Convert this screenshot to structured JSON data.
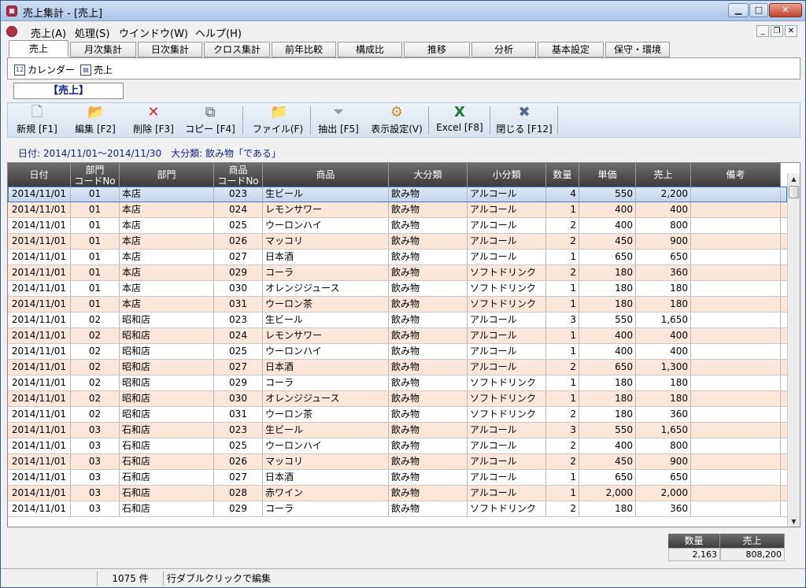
{
  "window": {
    "title": "売上集計 - [売上]"
  },
  "menu": [
    "売上(A)",
    "処理(S)",
    "ウインドウ(W)",
    "ヘルプ(H)"
  ],
  "tabs": [
    "売上",
    "月次集計",
    "日次集計",
    "クロス集計",
    "前年比較",
    "構成比",
    "推移",
    "分析",
    "基本設定",
    "保守・環境"
  ],
  "subnav": [
    {
      "label": "カレンダー",
      "icon": "calendar-icon"
    },
    {
      "label": "売上",
      "icon": "copy-icon"
    }
  ],
  "section_title": "【売上】",
  "toolbar": [
    {
      "label": "新規 [F1]",
      "icon": "new-document-icon"
    },
    {
      "label": "編集 [F2]",
      "icon": "edit-folder-icon"
    },
    {
      "label": "削除 [F3]",
      "icon": "delete-x-icon"
    },
    {
      "label": "コピー [F4]",
      "icon": "copy-icon"
    },
    {
      "label": "ファイル(F)",
      "icon": "folder-icon"
    },
    {
      "label": "抽出 [F5]",
      "icon": "filter-funnel-icon"
    },
    {
      "label": "表示設定(V)",
      "icon": "settings-joystick-icon"
    },
    {
      "label": "Excel [F8]",
      "icon": "excel-icon"
    },
    {
      "label": "閉じる [F12]",
      "icon": "close-x-icon"
    }
  ],
  "filter_text": "日付: 2014/11/01～2014/11/30　大分類: 飲み物「である」",
  "columns": [
    {
      "l1": "日付",
      "l2": ""
    },
    {
      "l1": "部門",
      "l2": "コードNo"
    },
    {
      "l1": "部門",
      "l2": ""
    },
    {
      "l1": "商品",
      "l2": "コードNo"
    },
    {
      "l1": "商品",
      "l2": ""
    },
    {
      "l1": "大分類",
      "l2": ""
    },
    {
      "l1": "小分類",
      "l2": ""
    },
    {
      "l1": "数量",
      "l2": ""
    },
    {
      "l1": "単価",
      "l2": ""
    },
    {
      "l1": "売上",
      "l2": ""
    },
    {
      "l1": "備考",
      "l2": ""
    }
  ],
  "rows": [
    [
      "2014/11/01",
      "01",
      "本店",
      "023",
      "生ビール",
      "飲み物",
      "アルコール",
      "4",
      "550",
      "2,200",
      ""
    ],
    [
      "2014/11/01",
      "01",
      "本店",
      "024",
      "レモンサワー",
      "飲み物",
      "アルコール",
      "1",
      "400",
      "400",
      ""
    ],
    [
      "2014/11/01",
      "01",
      "本店",
      "025",
      "ウーロンハイ",
      "飲み物",
      "アルコール",
      "2",
      "400",
      "800",
      ""
    ],
    [
      "2014/11/01",
      "01",
      "本店",
      "026",
      "マッコリ",
      "飲み物",
      "アルコール",
      "2",
      "450",
      "900",
      ""
    ],
    [
      "2014/11/01",
      "01",
      "本店",
      "027",
      "日本酒",
      "飲み物",
      "アルコール",
      "1",
      "650",
      "650",
      ""
    ],
    [
      "2014/11/01",
      "01",
      "本店",
      "029",
      "コーラ",
      "飲み物",
      "ソフトドリンク",
      "2",
      "180",
      "360",
      ""
    ],
    [
      "2014/11/01",
      "01",
      "本店",
      "030",
      "オレンジジュース",
      "飲み物",
      "ソフトドリンク",
      "1",
      "180",
      "180",
      ""
    ],
    [
      "2014/11/01",
      "01",
      "本店",
      "031",
      "ウーロン茶",
      "飲み物",
      "ソフトドリンク",
      "1",
      "180",
      "180",
      ""
    ],
    [
      "2014/11/01",
      "02",
      "昭和店",
      "023",
      "生ビール",
      "飲み物",
      "アルコール",
      "3",
      "550",
      "1,650",
      ""
    ],
    [
      "2014/11/01",
      "02",
      "昭和店",
      "024",
      "レモンサワー",
      "飲み物",
      "アルコール",
      "1",
      "400",
      "400",
      ""
    ],
    [
      "2014/11/01",
      "02",
      "昭和店",
      "025",
      "ウーロンハイ",
      "飲み物",
      "アルコール",
      "1",
      "400",
      "400",
      ""
    ],
    [
      "2014/11/01",
      "02",
      "昭和店",
      "027",
      "日本酒",
      "飲み物",
      "アルコール",
      "2",
      "650",
      "1,300",
      ""
    ],
    [
      "2014/11/01",
      "02",
      "昭和店",
      "029",
      "コーラ",
      "飲み物",
      "ソフトドリンク",
      "1",
      "180",
      "180",
      ""
    ],
    [
      "2014/11/01",
      "02",
      "昭和店",
      "030",
      "オレンジジュース",
      "飲み物",
      "ソフトドリンク",
      "1",
      "180",
      "180",
      ""
    ],
    [
      "2014/11/01",
      "02",
      "昭和店",
      "031",
      "ウーロン茶",
      "飲み物",
      "ソフトドリンク",
      "2",
      "180",
      "360",
      ""
    ],
    [
      "2014/11/01",
      "03",
      "石和店",
      "023",
      "生ビール",
      "飲み物",
      "アルコール",
      "3",
      "550",
      "1,650",
      ""
    ],
    [
      "2014/11/01",
      "03",
      "石和店",
      "025",
      "ウーロンハイ",
      "飲み物",
      "アルコール",
      "2",
      "400",
      "800",
      ""
    ],
    [
      "2014/11/01",
      "03",
      "石和店",
      "026",
      "マッコリ",
      "飲み物",
      "アルコール",
      "2",
      "450",
      "900",
      ""
    ],
    [
      "2014/11/01",
      "03",
      "石和店",
      "027",
      "日本酒",
      "飲み物",
      "アルコール",
      "1",
      "650",
      "650",
      ""
    ],
    [
      "2014/11/01",
      "03",
      "石和店",
      "028",
      "赤ワイン",
      "飲み物",
      "アルコール",
      "1",
      "2,000",
      "2,000",
      ""
    ],
    [
      "2014/11/01",
      "03",
      "石和店",
      "029",
      "コーラ",
      "飲み物",
      "ソフトドリンク",
      "2",
      "180",
      "360",
      ""
    ]
  ],
  "totals": {
    "qty_label": "数量",
    "sales_label": "売上",
    "qty": "2,163",
    "sales": "808,200"
  },
  "status": {
    "count": "1075 件",
    "hint": "行ダブルクリックで編集"
  }
}
